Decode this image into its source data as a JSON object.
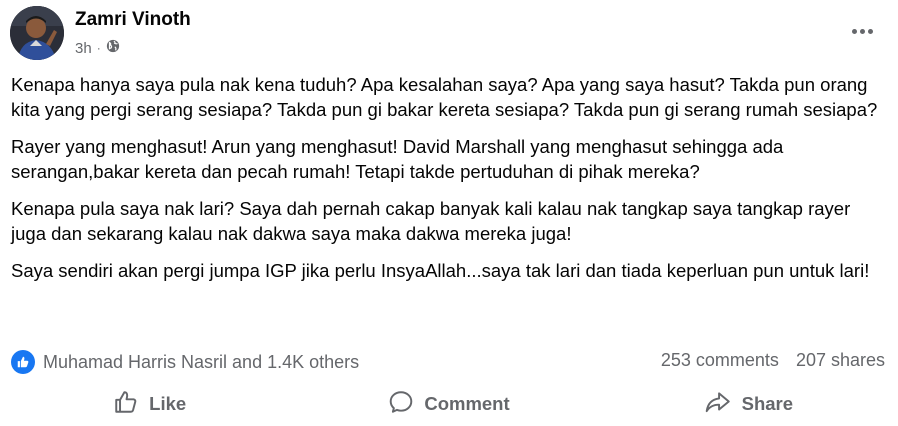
{
  "post": {
    "author": "Zamri Vinoth",
    "time": "3h",
    "privacy_icon": "globe-icon",
    "paragraphs": [
      "Kenapa hanya saya pula nak kena tuduh? Apa kesalahan saya? Apa yang saya hasut? Takda pun orang kita yang pergi serang sesiapa? Takda pun gi bakar kereta sesiapa? Takda pun gi serang rumah sesiapa?",
      "Rayer yang menghasut! Arun yang menghasut! David Marshall yang menghasut sehingga ada serangan,bakar kereta dan pecah rumah! Tetapi takde pertuduhan di pihak mereka?",
      "Kenapa pula saya nak lari? Saya dah pernah cakap banyak kali kalau nak tangkap saya tangkap rayer juga dan sekarang kalau nak dakwa saya maka dakwa mereka juga!",
      "Saya sendiri akan pergi jumpa IGP jika perlu InsyaAllah...saya tak lari dan tiada keperluan pun untuk lari!"
    ]
  },
  "stats": {
    "reactions": "Muhamad Harris Nasril and 1.4K others",
    "comments": "253 comments",
    "shares": "207 shares"
  },
  "actions": {
    "like": "Like",
    "comment": "Comment",
    "share": "Share"
  },
  "colors": {
    "accent": "#1877f2",
    "secondary_text": "#65676b"
  }
}
